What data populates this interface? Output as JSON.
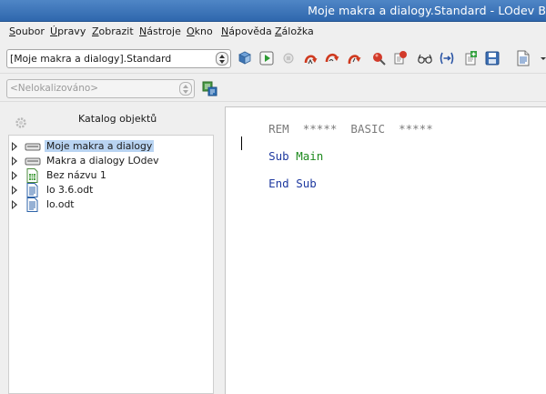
{
  "window": {
    "title": "Moje makra a dialogy.Standard - LOdev B"
  },
  "menu": {
    "items": [
      "Soubor",
      "Úpravy",
      "Zobrazit",
      "Nástroje",
      "Okno",
      "Nápověda",
      "Záložka"
    ]
  },
  "toolbar": {
    "library_select": "[Moje makra a dialogy].Standard",
    "language_select": "<Nelokalizováno>",
    "icons": [
      "compile-icon",
      "run-icon",
      "stop-icon",
      "step-into-icon",
      "step-over-icon",
      "step-out-icon",
      "breakpoint-icon",
      "manage-breakpoints-icon",
      "watch-icon",
      "find-parentheses-icon",
      "insert-source-icon",
      "save-source-icon",
      "select-module-icon",
      "overflow-icon",
      "manage-language-icon"
    ]
  },
  "catalog": {
    "title": "Katalog objektů",
    "items": [
      {
        "label": "Moje makra a dialogy",
        "icon": "macro-container-icon",
        "selected": true
      },
      {
        "label": "Makra a dialogy LOdev",
        "icon": "macro-container-icon",
        "selected": false
      },
      {
        "label": "Bez názvu 1",
        "icon": "spreadsheet-icon",
        "selected": false
      },
      {
        "label": "lo 3.6.odt",
        "icon": "text-document-icon",
        "selected": false
      },
      {
        "label": "lo.odt",
        "icon": "text-document-icon",
        "selected": false
      }
    ]
  },
  "editor": {
    "lines": [
      {
        "parts": [
          {
            "text": "REM  *****  BASIC  *****",
            "class": "kw-grey"
          }
        ]
      },
      {
        "parts": [
          {
            "text": "Sub",
            "class": "kw-blue"
          },
          {
            "text": " ",
            "class": ""
          },
          {
            "text": "Main",
            "class": "kw-green"
          }
        ]
      },
      {
        "parts": [
          {
            "text": "End Sub",
            "class": "kw-blue"
          }
        ]
      }
    ]
  },
  "colors": {
    "titlebar": "#2f67ad",
    "selection": "#b9d4f2",
    "keyword": "#1f3aa0",
    "identifier": "#1e8a1e",
    "comment": "#7a7a7a"
  }
}
